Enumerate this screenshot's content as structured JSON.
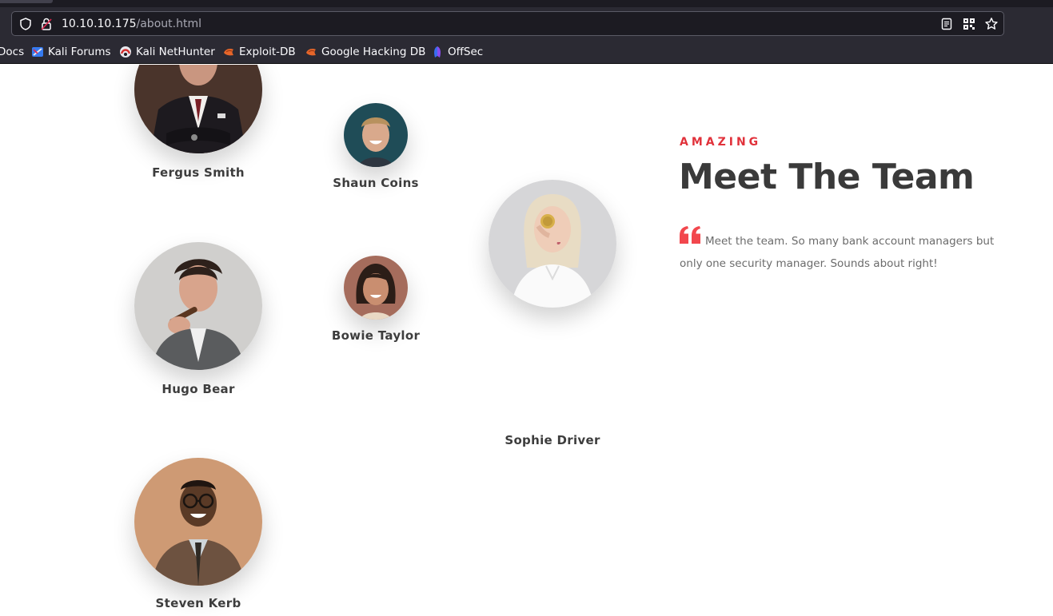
{
  "browser": {
    "url_host": "10.10.10.175",
    "url_path": "/about.html",
    "bookmarks": [
      {
        "label": "Docs",
        "icon": "kali-docs-icon"
      },
      {
        "label": "Kali Forums",
        "icon": "kali-forums-icon"
      },
      {
        "label": "Kali NetHunter",
        "icon": "kali-nethunter-icon"
      },
      {
        "label": "Exploit-DB",
        "icon": "exploit-db-icon"
      },
      {
        "label": "Google Hacking DB",
        "icon": "ghdb-icon"
      },
      {
        "label": "OffSec",
        "icon": "offsec-icon"
      }
    ]
  },
  "team": {
    "subheading": "AMAZING",
    "heading": "Meet The Team",
    "description": "Meet the team. So many bank account managers but only one security manager. Sounds about right!",
    "members": [
      {
        "name": "Fergus Smith"
      },
      {
        "name": "Shaun Coins"
      },
      {
        "name": "Sophie Driver"
      },
      {
        "name": "Hugo Bear"
      },
      {
        "name": "Bowie Taylor"
      },
      {
        "name": "Steven Kerb"
      }
    ]
  },
  "colors": {
    "accent": "#e1323b",
    "heading": "#3a3a3a",
    "body_text": "#6b6b6b",
    "chrome_bg": "#2b2a33",
    "urlbar_bg": "#1c1b22"
  }
}
